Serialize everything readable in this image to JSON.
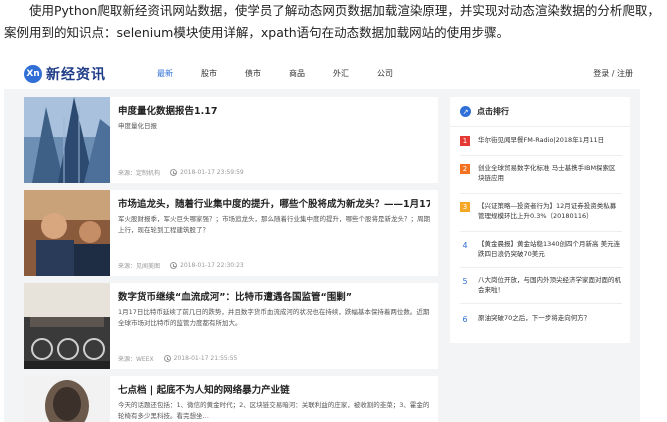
{
  "intro": {
    "text": "　　使用Python爬取新经资讯网站数据，使学员了解动态网页数据加载渲染原理，并实现对动态渲染数据的分析爬取，案例用到的知识点：selenium模块使用详解，xpath语句在动态数据加载网站的使用步骤。"
  },
  "header": {
    "logo_mark": "Xn",
    "logo_text": "新经资讯",
    "nav": [
      "最新",
      "股市",
      "债市",
      "商品",
      "外汇",
      "公司"
    ],
    "login": "登录 / 注册"
  },
  "articles": [
    {
      "title": "申度量化数据报告1.17",
      "desc": "申度量化日报",
      "source": "来源：定制机构",
      "time": "2018-01-17 23:59:59"
    },
    {
      "title": "市场追龙头，随着行业集中度的提升，哪些个股将成为新龙头？——1月17...",
      "desc": "军火股财报季，军火巨头哪家强？；市场追龙头，那么随着行业集中度的提升，哪些个股将是新龙头？；周期上行，现在轮到工程建筑股了？",
      "source": "来源：见闻美图",
      "time": "2018-01-17 22:30:23"
    },
    {
      "title": "数字货币继续“血流成河”：比特币遭遇各国监管“围剿”",
      "desc": "1月17日比特币延续了前几日的跌势，并且数字货币血流成河的状况也在持续，跌幅基本保持着两位数。近期全球市场对比特币的监管力度都有所加大。",
      "source": "来源：WEEX",
      "time": "2018-01-17 21:55:55"
    },
    {
      "title": "七点档 | 起底不为人知的网络暴力产业链",
      "desc": "今天的话题还包括：1、微信的黄金时代；2、区块链交易暗河：关联利益的庄家，被收割的韭菜；3、霍金的轮椅有多少黑科技。看完想坐…",
      "source": "",
      "time": ""
    }
  ],
  "sidebar": {
    "icon": "trend-icon",
    "title": "点击排行",
    "items": [
      {
        "rank": "1",
        "text": "华尔街见闻早餐FM-Radio|2018年1月11日",
        "color": "#e53935"
      },
      {
        "rank": "2",
        "text": "创业全球贸易数字化标准 马士基携手IBM探索区块链应用",
        "color": "#f4711f"
      },
      {
        "rank": "3",
        "text": "【兴证策略—投资者行为】12月证券投资类私募管理规模环比上升0.3%（20180116）",
        "color": "#f5a623"
      },
      {
        "rank": "4",
        "text": "【黄金晨报】黄金站稳1340创四个月新高 美元连跌四日浪仍突破70美元",
        "color": ""
      },
      {
        "rank": "5",
        "text": "八大岗位开放，与国内外顶尖经济学家面对面的机会来啦！",
        "color": ""
      },
      {
        "rank": "6",
        "text": "原油突破70之后，下一步将走向何方？",
        "color": ""
      }
    ]
  },
  "colors": {
    "accent": "#2f6fd6",
    "page_bg": "#f3f4f6"
  }
}
